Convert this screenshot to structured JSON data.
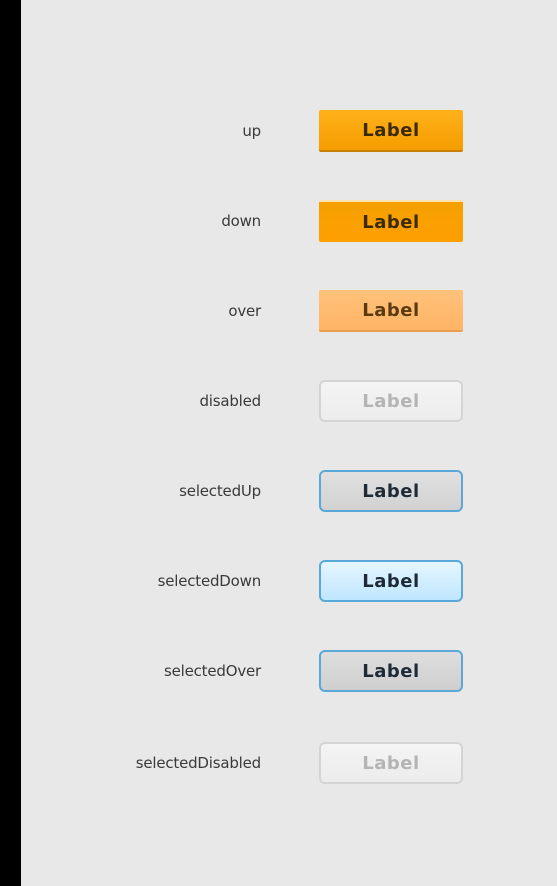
{
  "rows": [
    {
      "state": "up",
      "button_label": "Label"
    },
    {
      "state": "down",
      "button_label": "Label"
    },
    {
      "state": "over",
      "button_label": "Label"
    },
    {
      "state": "disabled",
      "button_label": "Label"
    },
    {
      "state": "selectedUp",
      "button_label": "Label"
    },
    {
      "state": "selectedDown",
      "button_label": "Label"
    },
    {
      "state": "selectedOver",
      "button_label": "Label"
    },
    {
      "state": "selectedDisabled",
      "button_label": "Label"
    }
  ],
  "colors": {
    "page_background": "#000000",
    "panel_background": "#e8e8e8",
    "orange_up": "#ffa500",
    "orange_over": "#ffb870",
    "selected_border": "#5aa8d8",
    "selected_down_fill": "#cdeeff",
    "disabled_text": "#b4b4b4"
  }
}
